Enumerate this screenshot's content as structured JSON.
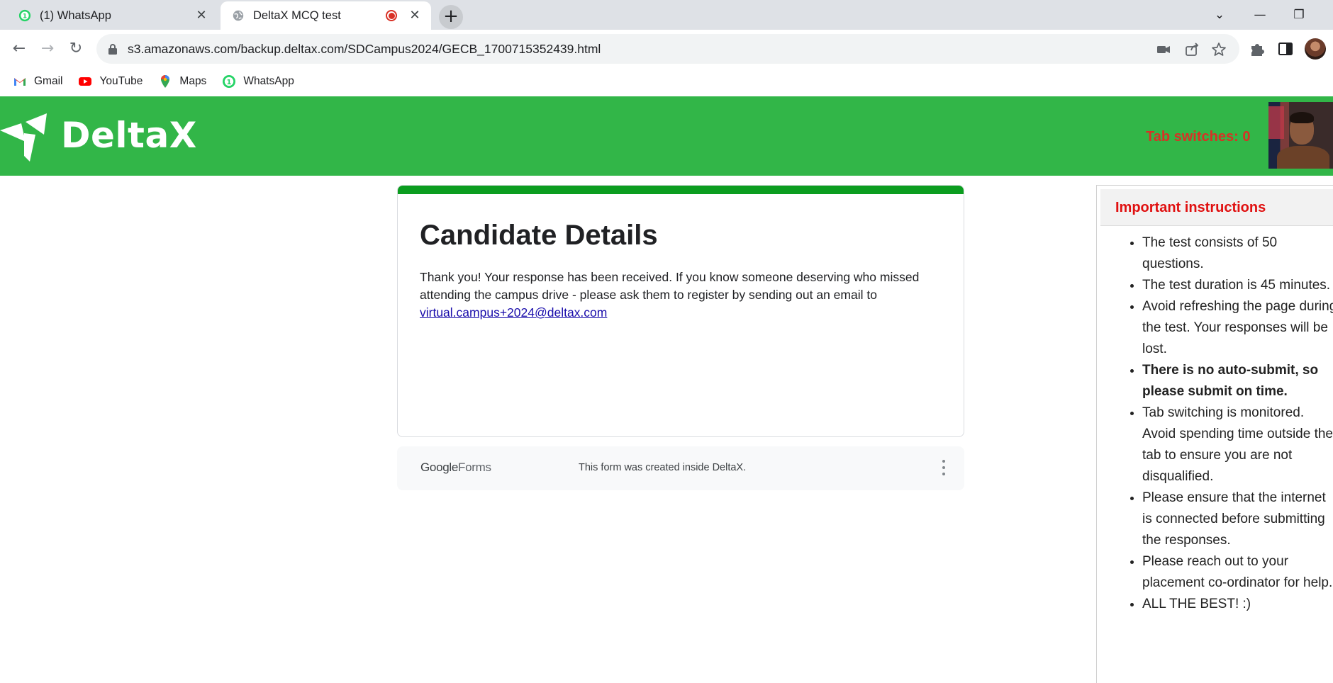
{
  "browser": {
    "tabs": [
      {
        "title": "(1) WhatsApp",
        "active": false
      },
      {
        "title": "DeltaX MCQ test",
        "active": true,
        "recording": true
      }
    ],
    "new_tab_label": "+",
    "address_bar": {
      "url": "s3.amazonaws.com/backup.deltax.com/SDCampus2024/GECB_1700715352439.html"
    },
    "bookmarks": [
      {
        "label": "Gmail",
        "icon": "gmail-icon"
      },
      {
        "label": "YouTube",
        "icon": "youtube-icon"
      },
      {
        "label": "Maps",
        "icon": "maps-icon"
      },
      {
        "label": "WhatsApp",
        "icon": "whatsapp-icon"
      }
    ]
  },
  "site": {
    "brand": "DeltaX",
    "tab_switches": "Tab switches: 0",
    "brand_color": "#32b648"
  },
  "form": {
    "title": "Candidate Details",
    "message": "Thank you! Your response has been received. If you know someone deserving who missed attending the campus drive - please ask them to register by sending out an email to",
    "email_link": "virtual.campus+2024@deltax.com",
    "accent_color": "#0b9d1f"
  },
  "footer": {
    "logo_google": "Google",
    "logo_forms": "Forms",
    "note": "This form was created inside DeltaX."
  },
  "instructions": {
    "title": "Important instructions",
    "items": [
      {
        "text": "The test consists of 50 questions."
      },
      {
        "text": "The test duration is 45 minutes."
      },
      {
        "text": "Avoid refreshing the page during the test. Your responses will be lost."
      },
      {
        "text": "There is no auto-submit, so please submit on time."
      },
      {
        "text": "Tab switching is monitored. Avoid spending time outside the tab to ensure you are not disqualified."
      },
      {
        "text": "Please ensure that the internet is connected before submitting the responses."
      },
      {
        "text": "Please reach out to your placement co-ordinator for help."
      },
      {
        "text": "ALL THE BEST! :)"
      }
    ]
  }
}
